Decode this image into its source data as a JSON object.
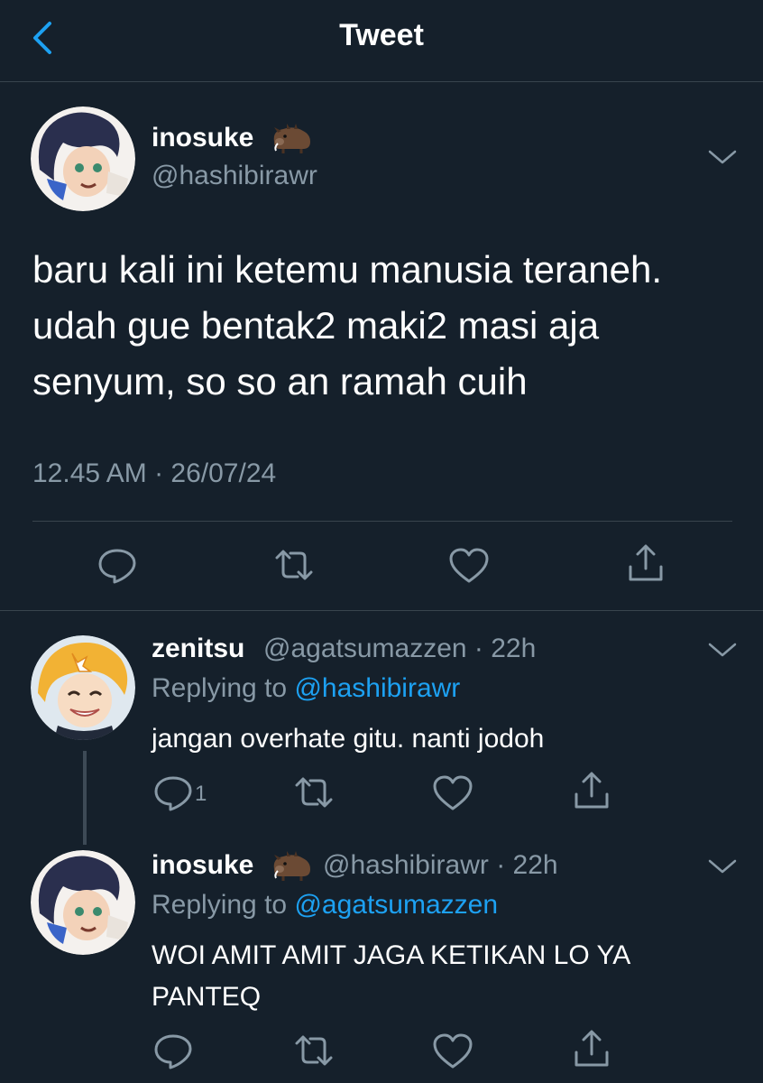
{
  "header": {
    "title": "Tweet"
  },
  "main_tweet": {
    "name": "inosuke",
    "handle": "@hashibirawr",
    "text": "baru kali ini ketemu manusia teraneh. udah gue bentak2 maki2 masi aja senyum, so so an ramah cuih",
    "timestamp": "12.45 AM · 26/07/24"
  },
  "replies": [
    {
      "name": "zenitsu",
      "handle": "@agatsumazzen",
      "time": "· 22h",
      "replying_prefix": "Replying to ",
      "replying_to": "@hashibirawr",
      "text": "jangan overhate gitu. nanti jodoh",
      "reply_count": "1"
    },
    {
      "name": "inosuke",
      "handle": "@hashibirawr",
      "time": "· 22h",
      "replying_prefix": "Replying to ",
      "replying_to": "@agatsumazzen",
      "text": "WOI AMIT AMIT JAGA KETIKAN LO YA PANTEQ"
    }
  ],
  "icons": [
    "back-icon",
    "boar-emoji-icon",
    "chevron-down-icon",
    "reply-icon",
    "retweet-icon",
    "like-icon",
    "share-icon"
  ],
  "colors": {
    "background": "#15202b",
    "secondary_text": "#8899a6",
    "accent": "#1da1f2",
    "divider": "#38444d"
  }
}
